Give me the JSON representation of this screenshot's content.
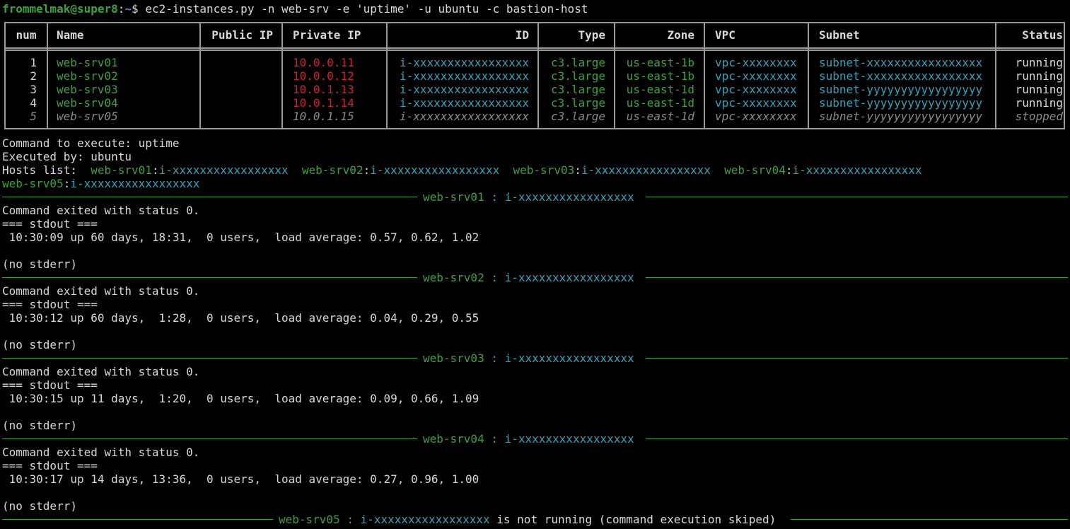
{
  "prompt": {
    "user_host": "frommelmak@super8",
    "path": "~",
    "symbol": "$",
    "command": " ec2-instances.py -n web-srv -e 'uptime' -u ubuntu -c bastion-host"
  },
  "table": {
    "headers": [
      "num",
      "Name",
      "Public IP",
      "Private IP",
      "ID",
      "Type",
      "Zone",
      "VPC",
      "Subnet",
      "Status"
    ],
    "rows": [
      {
        "num": "1",
        "name": "web-srv01",
        "public_ip": "",
        "private_ip": "10.0.0.11",
        "id": "i-xxxxxxxxxxxxxxxxx",
        "type": "c3.large",
        "zone": "us-east-1b",
        "vpc": "vpc-xxxxxxxx",
        "subnet": "subnet-xxxxxxxxxxxxxxxxx",
        "status": "running",
        "stopped": false
      },
      {
        "num": "2",
        "name": "web-srv02",
        "public_ip": "",
        "private_ip": "10.0.0.12",
        "id": "i-xxxxxxxxxxxxxxxxx",
        "type": "c3.large",
        "zone": "us-east-1b",
        "vpc": "vpc-xxxxxxxx",
        "subnet": "subnet-xxxxxxxxxxxxxxxxx",
        "status": "running",
        "stopped": false
      },
      {
        "num": "3",
        "name": "web-srv03",
        "public_ip": "",
        "private_ip": "10.0.1.13",
        "id": "i-xxxxxxxxxxxxxxxxx",
        "type": "c3.large",
        "zone": "us-east-1d",
        "vpc": "vpc-xxxxxxxx",
        "subnet": "subnet-yyyyyyyyyyyyyyyyy",
        "status": "running",
        "stopped": false
      },
      {
        "num": "4",
        "name": "web-srv04",
        "public_ip": "",
        "private_ip": "10.0.1.14",
        "id": "i-xxxxxxxxxxxxxxxxx",
        "type": "c3.large",
        "zone": "us-east-1d",
        "vpc": "vpc-xxxxxxxx",
        "subnet": "subnet-yyyyyyyyyyyyyyyyy",
        "status": "running",
        "stopped": false
      },
      {
        "num": "5",
        "name": "web-srv05",
        "public_ip": "",
        "private_ip": "10.0.1.15",
        "id": "i-xxxxxxxxxxxxxxxxx",
        "type": "c3.large",
        "zone": "us-east-1d",
        "vpc": "vpc-xxxxxxxx",
        "subnet": "subnet-yyyyyyyyyyyyyyyyy",
        "status": "stopped",
        "stopped": true
      }
    ]
  },
  "info": {
    "command_label": "Command to execute: ",
    "command": "uptime",
    "executed_label": "Executed by: ",
    "executed_by": "ubuntu",
    "hosts_label": "Hosts list:  ",
    "hosts": [
      {
        "name": "web-srv01",
        "id": "i-xxxxxxxxxxxxxxxxx"
      },
      {
        "name": "web-srv02",
        "id": "i-xxxxxxxxxxxxxxxxx"
      },
      {
        "name": "web-srv03",
        "id": "i-xxxxxxxxxxxxxxxxx"
      },
      {
        "name": "web-srv04",
        "id": "i-xxxxxxxxxxxxxxxxx"
      },
      {
        "name": "web-srv05",
        "id": "i-xxxxxxxxxxxxxxxxx"
      }
    ]
  },
  "sections": [
    {
      "name": "web-srv01",
      "id": "i-xxxxxxxxxxxxxxxxx",
      "exit": "Command exited with status 0.",
      "stdout_header": "=== stdout ===",
      "stdout": " 10:30:09 up 60 days, 18:31,  0 users,  load average: 0.57, 0.62, 1.02",
      "stderr": "(no stderr)"
    },
    {
      "name": "web-srv02",
      "id": "i-xxxxxxxxxxxxxxxxx",
      "exit": "Command exited with status 0.",
      "stdout_header": "=== stdout ===",
      "stdout": " 10:30:12 up 60 days,  1:28,  0 users,  load average: 0.04, 0.29, 0.55",
      "stderr": "(no stderr)"
    },
    {
      "name": "web-srv03",
      "id": "i-xxxxxxxxxxxxxxxxx",
      "exit": "Command exited with status 0.",
      "stdout_header": "=== stdout ===",
      "stdout": " 10:30:15 up 11 days,  1:20,  0 users,  load average: 0.09, 0.66, 1.09",
      "stderr": "(no stderr)"
    },
    {
      "name": "web-srv04",
      "id": "i-xxxxxxxxxxxxxxxxx",
      "exit": "Command exited with status 0.",
      "stdout_header": "=== stdout ===",
      "stdout": " 10:30:17 up 14 days, 13:36,  0 users,  load average: 0.27, 0.96, 1.00",
      "stderr": "(no stderr)"
    }
  ],
  "final": {
    "name": "web-srv05",
    "id": "i-xxxxxxxxxxxxxxxxx",
    "message": " is not running (command execution skiped)"
  }
}
